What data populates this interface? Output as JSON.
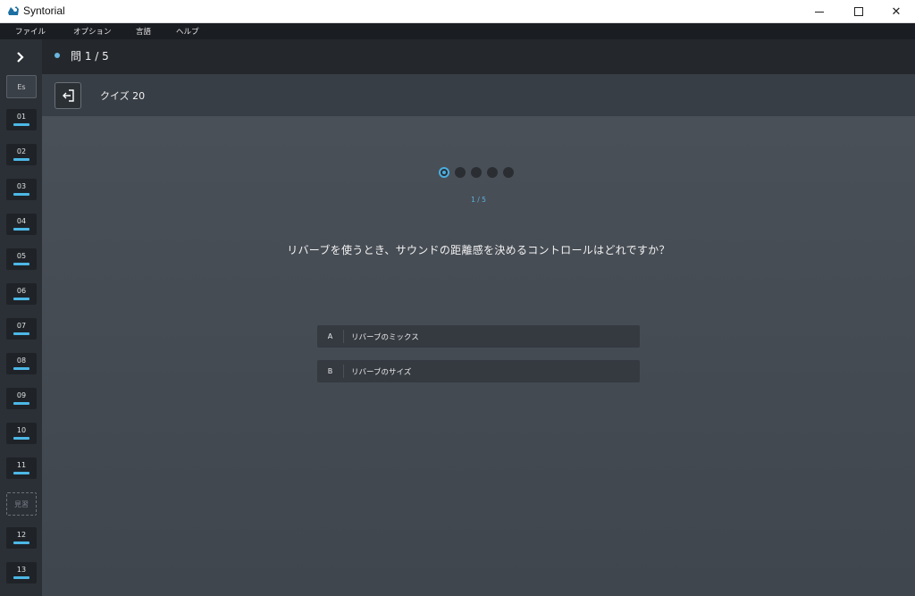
{
  "window": {
    "title": "Syntorial",
    "minimize": "",
    "maximize": "",
    "close": "✕"
  },
  "menu": [
    "ファイル",
    "オプション",
    "言語",
    "ヘルプ"
  ],
  "sidebar": {
    "toggle": "›",
    "es_label": "Es",
    "lessons": [
      "01",
      "02",
      "03",
      "04",
      "05",
      "06",
      "07",
      "08",
      "09",
      "10",
      "11"
    ],
    "review_label": "見習",
    "lessons_after": [
      "12",
      "13"
    ],
    "accent": "#4cb8e6"
  },
  "header": {
    "question_label": "問 1 / 5"
  },
  "quiz": {
    "title": "クイズ 20",
    "progress_text": "1 / 5",
    "question": "リバーブを使うとき、サウンドの距離感を決めるコントロールはどれですか？",
    "options": [
      {
        "letter": "A",
        "text": "リバーブのミックス"
      },
      {
        "letter": "B",
        "text": "リバーブのサイズ"
      }
    ],
    "current": 1,
    "total": 5
  }
}
